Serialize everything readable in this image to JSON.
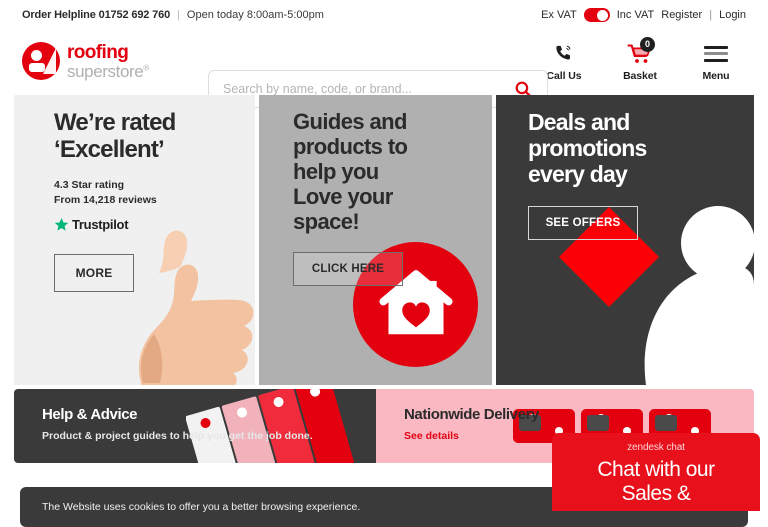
{
  "topbar": {
    "helpline_label": "Order Helpline 01752 692 760",
    "separator": "|",
    "opening_hours": "Open today 8:00am-5:00pm",
    "vat_ex_label": "Ex VAT",
    "vat_inc_label": "Inc VAT",
    "register_label": "Register",
    "account_separator": "|",
    "login_label": "Login"
  },
  "header": {
    "logo_line1": "roofing",
    "logo_line2": "superstore",
    "logo_trademark": "®",
    "search_placeholder": "Search by name, code, or brand...",
    "search_value": "",
    "search_icon": "search-icon",
    "actions": [
      {
        "label": "Call Us",
        "icon": "phone-icon"
      },
      {
        "label": "Basket",
        "icon": "shopping-cart-icon",
        "badge": "0"
      },
      {
        "label": "Menu",
        "icon": "hamburger-menu-icon"
      }
    ]
  },
  "hero": {
    "tiles": [
      {
        "heading_line1": "We’re rated",
        "heading_line2": "‘Excellent’",
        "sub_line1": "4.3 Star rating",
        "sub_line2": "From 14,218 reviews",
        "review_brand": "Trustpilot",
        "button_label": "MORE",
        "background": "#f0f0f0",
        "art": "thumbs-up-hand-image"
      },
      {
        "heading_line1": "Guides and",
        "heading_line2": "products to",
        "heading_line3": "help you",
        "heading_line4": "Love your",
        "heading_line5": "space!",
        "button_label": "CLICK HERE",
        "background": "#b0b0b0",
        "art": "house-heart-icon"
      },
      {
        "heading_line1": "Deals and",
        "heading_line2": "promotions",
        "heading_line3": "every day",
        "button_label": "SEE OFFERS",
        "background": "#3a3a3a",
        "art": "person-figure-graphic"
      }
    ]
  },
  "promos": [
    {
      "title": "Help & Advice",
      "subtitle": "Product & project guides to help you get the job done.",
      "background": "#3a3a3a",
      "art": "guide-booklets-image"
    },
    {
      "title": "Nationwide Delivery",
      "subtitle": "See details",
      "background": "#f9b8c2",
      "art": "delivery-trucks-image"
    }
  ],
  "cookie_notice": {
    "text": "The Website uses cookies to offer you a better browsing experience."
  },
  "chat_widget": {
    "provider_label": "zendesk chat",
    "headline_line1": "Chat with our",
    "headline_line2": "Sales &",
    "background": "#e8101a"
  },
  "colors": {
    "brand_red": "#e3000f",
    "chat_red": "#e8101a",
    "dark": "#3a3a3a",
    "mid_gray": "#b0b0b0",
    "light_gray": "#f0f0f0",
    "pink": "#f9b8c2",
    "trustpilot_green": "#00b67a"
  }
}
